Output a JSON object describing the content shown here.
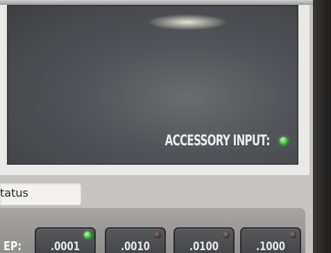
{
  "display": {
    "accessory_input_label": "ACCESSORY INPUT:",
    "accessory_input_led": "on"
  },
  "status": {
    "text": "tatus"
  },
  "step": {
    "label": "EP:",
    "buttons": [
      {
        "label": ".0001",
        "led": "on"
      },
      {
        "label": ".0010",
        "led": "off"
      },
      {
        "label": ".0100",
        "led": "off"
      },
      {
        "label": ".1000",
        "led": "off"
      }
    ]
  },
  "colors": {
    "led_on": "#3ad83a",
    "led_off": "#3a2b2b",
    "display_bg": "#54555a",
    "button_bg": "#4a4c4f"
  }
}
